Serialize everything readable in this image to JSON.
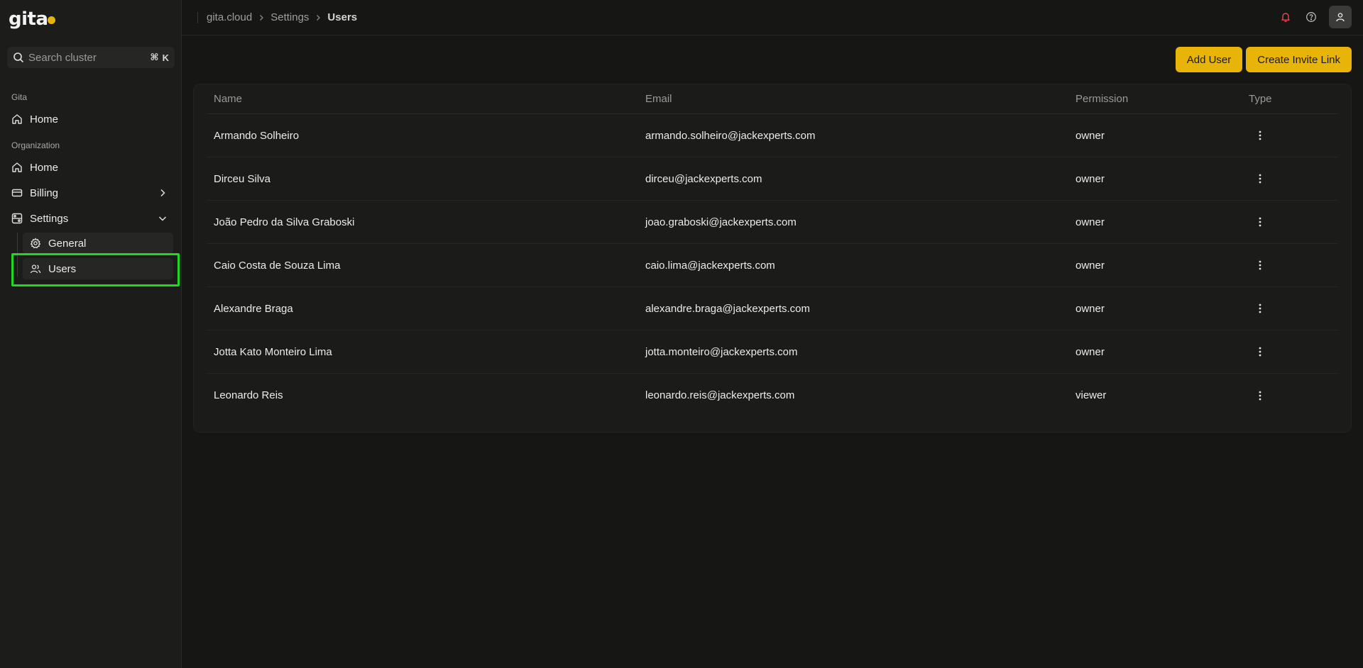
{
  "app": {
    "logo_text": "gita",
    "search_placeholder": "Search cluster",
    "search_shortcut_mod": "⌘",
    "search_shortcut_key": "K"
  },
  "sidebar": {
    "section_gita": "Gita",
    "gita_home": "Home",
    "section_org": "Organization",
    "org_home": "Home",
    "billing": "Billing",
    "settings": "Settings",
    "general": "General",
    "users": "Users"
  },
  "breadcrumb": {
    "items": [
      "gita.cloud",
      "Settings",
      "Users"
    ]
  },
  "toolbar": {
    "add_user": "Add User",
    "create_invite": "Create Invite Link"
  },
  "table": {
    "headers": [
      "Name",
      "Email",
      "Permission",
      "Type"
    ],
    "rows": [
      {
        "name": "Armando Solheiro",
        "email": "armando.solheiro@jackexperts.com",
        "permission": "owner"
      },
      {
        "name": "Dirceu Silva",
        "email": "dirceu@jackexperts.com",
        "permission": "owner"
      },
      {
        "name": "João Pedro da Silva Graboski",
        "email": "joao.graboski@jackexperts.com",
        "permission": "owner"
      },
      {
        "name": "Caio Costa de Souza Lima",
        "email": "caio.lima@jackexperts.com",
        "permission": "owner"
      },
      {
        "name": "Alexandre Braga",
        "email": "alexandre.braga@jackexperts.com",
        "permission": "owner"
      },
      {
        "name": "Jotta Kato Monteiro Lima",
        "email": "jotta.monteiro@jackexperts.com",
        "permission": "owner"
      },
      {
        "name": "Leonardo Reis",
        "email": "leonardo.reis@jackexperts.com",
        "permission": "viewer"
      }
    ]
  },
  "colors": {
    "accent": "#e8b407",
    "background": "#161615",
    "highlight": "#1fd81f",
    "notification": "#e5484d"
  }
}
